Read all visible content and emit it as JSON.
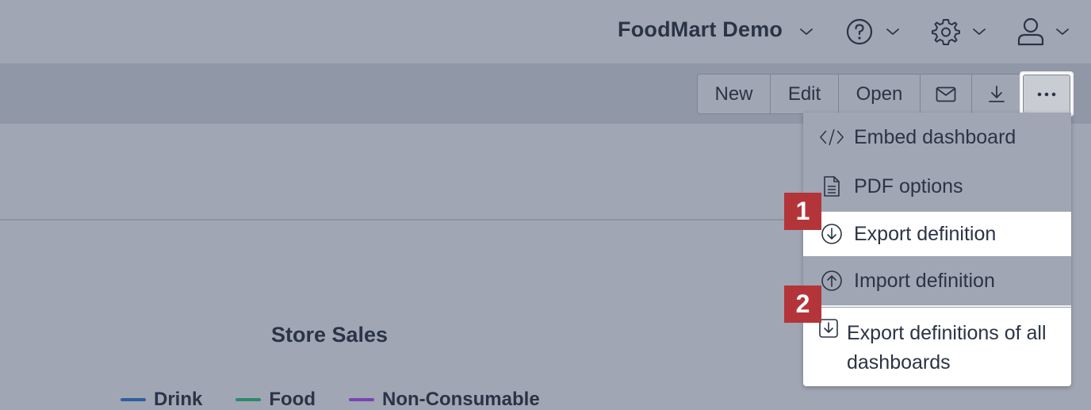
{
  "header": {
    "workspace_name": "FoodMart Demo",
    "icons": [
      "chevron-down-icon",
      "help-icon",
      "gear-icon",
      "user-icon"
    ]
  },
  "toolbar": {
    "new_label": "New",
    "edit_label": "Edit",
    "open_label": "Open",
    "icons": [
      "mail-icon",
      "download-icon",
      "more-icon"
    ]
  },
  "chart": {
    "title": "Store Sales",
    "legend": [
      {
        "label": "Drink",
        "color": "#2f5f9e"
      },
      {
        "label": "Food",
        "color": "#2e8a6a"
      },
      {
        "label": "Non-Consumable",
        "color": "#7a45b0"
      }
    ]
  },
  "menu": {
    "items": [
      {
        "label": "Embed dashboard",
        "icon": "code-icon"
      },
      {
        "label": "PDF options",
        "icon": "document-icon"
      },
      {
        "label": "Export definition",
        "icon": "circle-arrow-down-icon"
      },
      {
        "label": "Import definition",
        "icon": "circle-arrow-up-icon"
      },
      {
        "label": "Export definitions of all dashboards",
        "icon": "box-arrow-down-icon"
      }
    ]
  },
  "badges": {
    "one": "1",
    "two": "2",
    "color": "#b3353a"
  }
}
